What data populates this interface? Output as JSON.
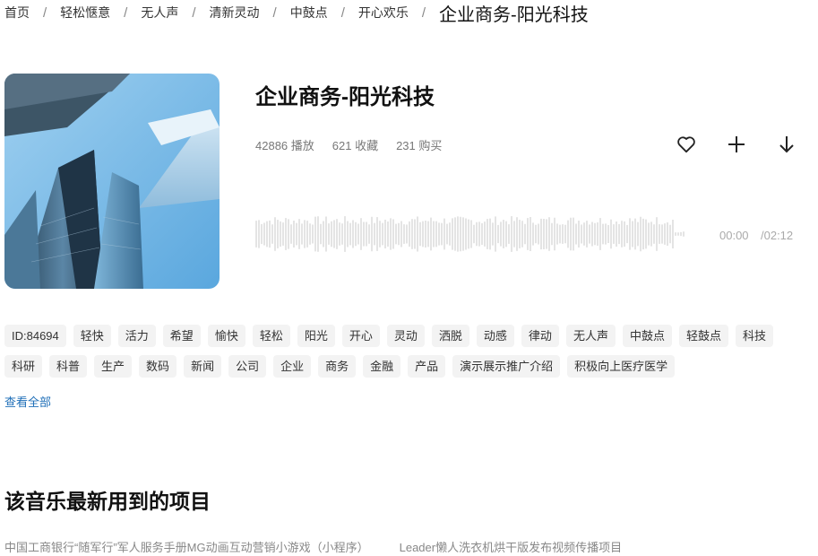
{
  "breadcrumb": {
    "items": [
      "首页",
      "轻松惬意",
      "无人声",
      "清新灵动",
      "中鼓点",
      "开心欢乐"
    ],
    "separator": "/",
    "current": "企业商务-阳光科技"
  },
  "track": {
    "title": "企业商务-阳光科技",
    "plays": "42886 播放",
    "favorites": "621 收藏",
    "purchases": "231 购买",
    "current_time": "00:00",
    "total_time": "/02:12"
  },
  "actions": {
    "icons": [
      "heart-icon",
      "plus-icon",
      "download-icon"
    ]
  },
  "tags": [
    "ID:84694",
    "轻快",
    "活力",
    "希望",
    "愉快",
    "轻松",
    "阳光",
    "开心",
    "灵动",
    "洒脱",
    "动感",
    "律动",
    "无人声",
    "中鼓点",
    "轻鼓点",
    "科技",
    "科研",
    "科普",
    "生产",
    "数码",
    "新闻",
    "公司",
    "企业",
    "商务",
    "金融",
    "产品",
    "演示展示推广介绍",
    "积极向上医疗医学"
  ],
  "view_all": "查看全部",
  "section": {
    "title": "该音乐最新用到的项目",
    "projects": [
      "中国工商银行“随军行”军人服务手册MG动画互动营销小游戏（小程序）",
      "Leader懒人洗衣机烘干版发布视频传播项目"
    ]
  },
  "colors": {
    "link": "#1f6fb8",
    "tag_bg": "#f3f3f3",
    "waveform": "#c8c8c8"
  }
}
